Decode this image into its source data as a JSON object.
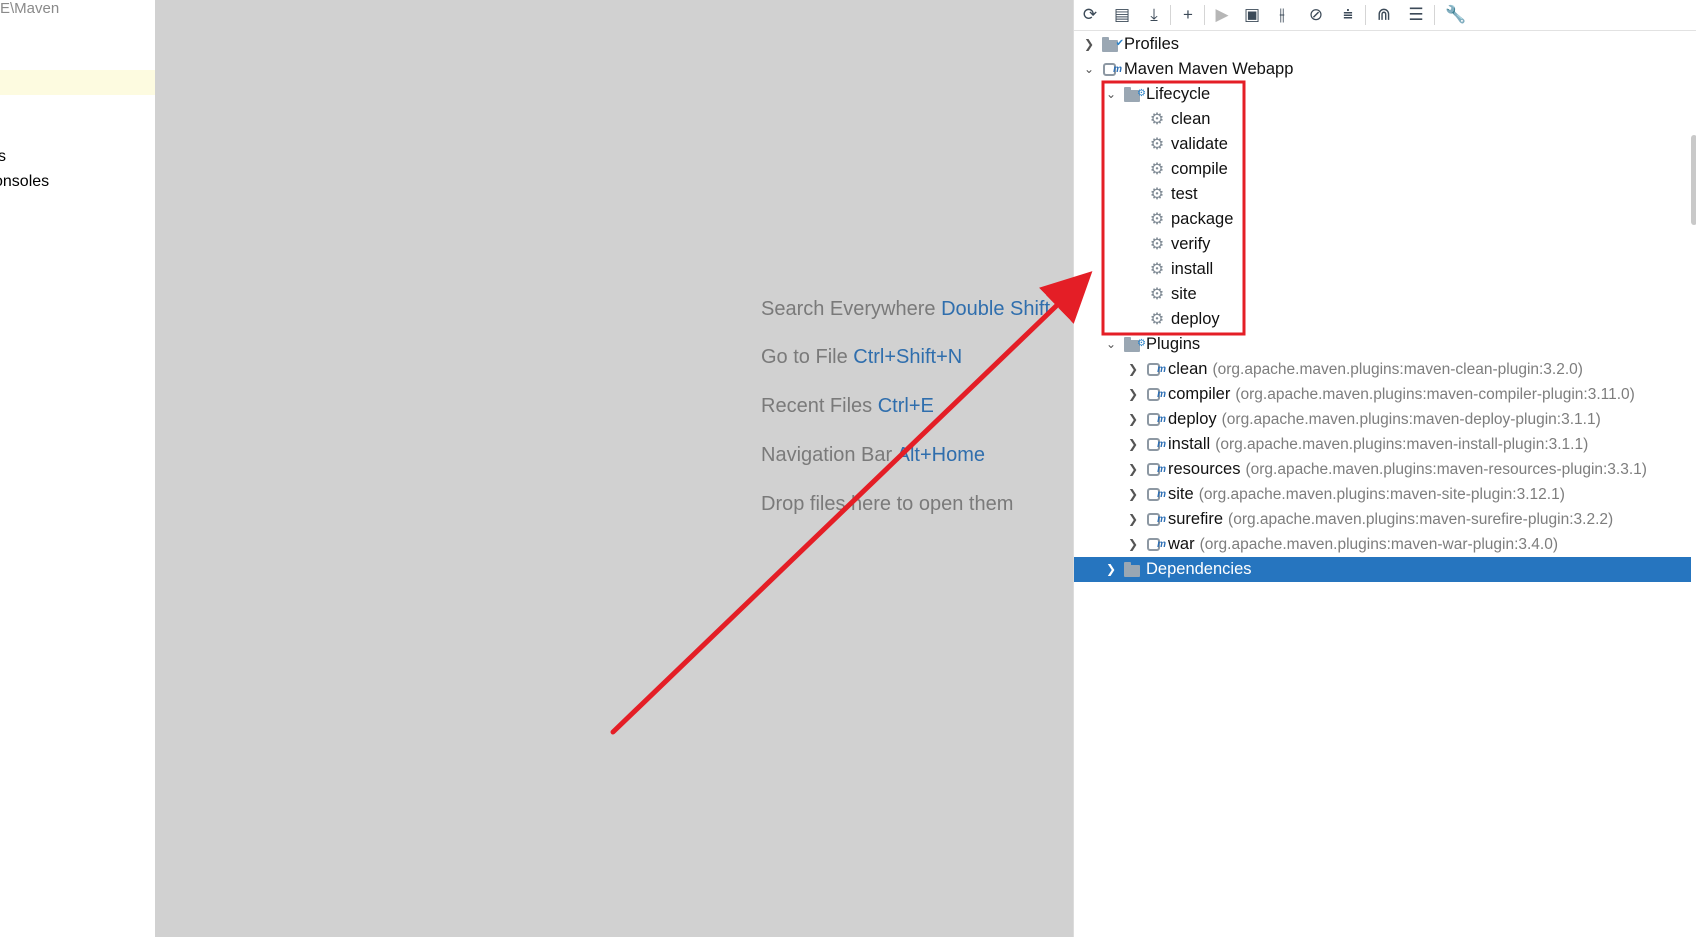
{
  "left_panel": {
    "path_fragment": "E\\Maven",
    "row1": "s",
    "row2": "onsoles"
  },
  "editor_hints": [
    {
      "text": "Search Everywhere",
      "key": "Double Shift"
    },
    {
      "text": "Go to File",
      "key": "Ctrl+Shift+N"
    },
    {
      "text": "Recent Files",
      "key": "Ctrl+E"
    },
    {
      "text": "Navigation Bar",
      "key": "Alt+Home"
    },
    {
      "text": "Drop files here to open them",
      "key": ""
    }
  ],
  "toolbar": {
    "icons": [
      "reload-icon",
      "reimport-icon",
      "download-icon",
      "add-icon",
      "run-icon",
      "run-config-icon",
      "toggle-offline-icon",
      "skip-tests-icon",
      "collapse-icon",
      "show-deps-icon",
      "expand-icon",
      "settings-wrench-icon"
    ]
  },
  "tree": {
    "profiles": "Profiles",
    "project": "Maven Maven Webapp",
    "lifecycle": "Lifecycle",
    "lifecycle_phases": [
      "clean",
      "validate",
      "compile",
      "test",
      "package",
      "verify",
      "install",
      "site",
      "deploy"
    ],
    "plugins": "Plugins",
    "plugin_items": [
      {
        "name": "clean",
        "coord": "(org.apache.maven.plugins:maven-clean-plugin:3.2.0)"
      },
      {
        "name": "compiler",
        "coord": "(org.apache.maven.plugins:maven-compiler-plugin:3.11.0)"
      },
      {
        "name": "deploy",
        "coord": "(org.apache.maven.plugins:maven-deploy-plugin:3.1.1)"
      },
      {
        "name": "install",
        "coord": "(org.apache.maven.plugins:maven-install-plugin:3.1.1)"
      },
      {
        "name": "resources",
        "coord": "(org.apache.maven.plugins:maven-resources-plugin:3.3.1)"
      },
      {
        "name": "site",
        "coord": "(org.apache.maven.plugins:maven-site-plugin:3.12.1)"
      },
      {
        "name": "surefire",
        "coord": "(org.apache.maven.plugins:maven-surefire-plugin:3.2.2)"
      },
      {
        "name": "war",
        "coord": "(org.apache.maven.plugins:maven-war-plugin:3.4.0)"
      }
    ],
    "dependencies": "Dependencies"
  },
  "colors": {
    "annotation": "#e41e26",
    "selection": "#2675bf",
    "key_hint": "#2f6ead"
  }
}
